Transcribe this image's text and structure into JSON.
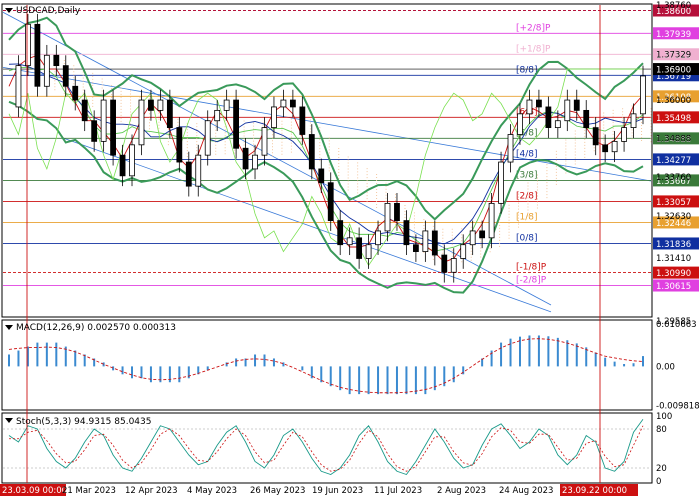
{
  "chart_data": {
    "type": "candlestick",
    "symbol_label": "USDCAD,Daily",
    "y_range": [
      1.2973,
      1.3876
    ],
    "y_ticks": [
      "1.38760",
      "1.37329",
      "1.36000",
      "1.34888",
      "1.33760",
      "1.32630",
      "1.31410",
      "1.29585"
    ],
    "x_ticks": [
      "23.03.09 00:00",
      "21 Mar 2023",
      "12 Apr 2023",
      "4 May 2023",
      "26 May 2023",
      "19 Jun 2023",
      "11 Jul 2023",
      "2 Aug 2023",
      "24 Aug 2023",
      "23.09.22 00:00"
    ],
    "close_path": [
      1.358,
      1.37,
      1.382,
      1.364,
      1.373,
      1.37,
      1.364,
      1.36,
      1.354,
      1.348,
      1.36,
      1.344,
      1.338,
      1.347,
      1.36,
      1.357,
      1.36,
      1.352,
      1.342,
      1.335,
      1.344,
      1.354,
      1.357,
      1.36,
      1.346,
      1.34,
      1.344,
      1.352,
      1.358,
      1.36,
      1.358,
      1.35,
      1.34,
      1.336,
      1.325,
      1.318,
      1.32,
      1.314,
      1.318,
      1.322,
      1.33,
      1.325,
      1.318,
      1.316,
      1.322,
      1.315,
      1.31,
      1.314,
      1.318,
      1.322,
      1.32,
      1.33,
      1.342,
      1.35,
      1.356,
      1.36,
      1.358,
      1.352,
      1.354,
      1.36,
      1.357,
      1.352,
      1.347,
      1.345,
      1.348,
      1.352,
      1.356,
      1.367
    ],
    "murrey_levels": [
      {
        "price": "1.38600",
        "label": "",
        "color": "#b5103a",
        "line": "#b5103a"
      },
      {
        "price": "1.37939",
        "label": "[+2/8]P",
        "color": "#e040e0",
        "line": "#e040e0"
      },
      {
        "price": "1.37329",
        "label": "[+1/8]P",
        "color": "#f0b0d0",
        "line": "#f0b0d0"
      },
      {
        "price": "1.36719",
        "label": "[8/8]",
        "color": "#1030a0",
        "line": "#1030a0"
      },
      {
        "price": "1.36108",
        "label": "",
        "color": "#e8a030",
        "line": "#e8a030"
      },
      {
        "price": "1.35498",
        "label": "[6/8]",
        "color": "#cc1010",
        "line": "#cc1010"
      },
      {
        "price": "1.34888",
        "label": "[5/8]",
        "color": "#3a7a3a",
        "line": "#3a7a3a"
      },
      {
        "price": "1.34277",
        "label": "[4/8]",
        "color": "#1030a0",
        "line": "#1030a0"
      },
      {
        "price": "1.33667",
        "label": "[3/8]",
        "color": "#3a7a3a",
        "line": "#3a7a3a"
      },
      {
        "price": "1.33057",
        "label": "[2/8]",
        "color": "#cc1010",
        "line": "#cc1010"
      },
      {
        "price": "1.32446",
        "label": "[1/8]",
        "color": "#e8a030",
        "line": "#e8a030"
      },
      {
        "price": "1.31836",
        "label": "[0/8]",
        "color": "#1030a0",
        "line": "#1030a0"
      },
      {
        "price": "1.30990",
        "label": "[-1/8]P",
        "color": "#cc1010",
        "line": "#cc1010"
      },
      {
        "price": "1.30615",
        "label": "[-2/8]P",
        "color": "#e040e0",
        "line": "#e040e0"
      }
    ],
    "price_badge": {
      "value": "1.36900",
      "color": "#000000"
    },
    "macd": {
      "title": "MACD(12,26,9) 0.002570 0.000313",
      "y_ticks": [
        "0.010663",
        "0.00",
        "-0.009818"
      ],
      "y_range": [
        -0.0105,
        0.0112
      ],
      "hist": [
        0.003,
        0.004,
        0.005,
        0.006,
        0.006,
        0.006,
        0.005,
        0.004,
        0.003,
        0.002,
        0.001,
        -0.001,
        -0.002,
        -0.003,
        -0.003,
        -0.004,
        -0.004,
        -0.004,
        -0.004,
        -0.003,
        -0.002,
        -0.001,
        0.0,
        0.001,
        0.002,
        0.002,
        0.003,
        0.003,
        0.002,
        0.001,
        0.0,
        -0.001,
        -0.003,
        -0.004,
        -0.005,
        -0.006,
        -0.007,
        -0.007,
        -0.007,
        -0.007,
        -0.007,
        -0.007,
        -0.007,
        -0.007,
        -0.007,
        -0.006,
        -0.005,
        -0.004,
        -0.002,
        0.0,
        0.002,
        0.004,
        0.006,
        0.007,
        0.0075,
        0.0078,
        0.0078,
        0.0076,
        0.0072,
        0.0066,
        0.0058,
        0.0048,
        0.0035,
        0.0022,
        0.0012,
        0.0006,
        0.0008,
        0.0026
      ],
      "signal_color": "#cc1010",
      "hist_color": "#3a8ad0"
    },
    "stoch": {
      "title": "Stoch(5,3,3) 94.9315 85.0435",
      "y_ticks": [
        "100",
        "80",
        "20",
        "0"
      ],
      "levels": [
        80,
        20
      ],
      "k": [
        70,
        60,
        85,
        80,
        50,
        30,
        20,
        35,
        60,
        80,
        70,
        40,
        20,
        15,
        35,
        60,
        85,
        80,
        60,
        40,
        25,
        30,
        55,
        75,
        85,
        60,
        30,
        20,
        40,
        70,
        80,
        60,
        35,
        15,
        10,
        20,
        40,
        70,
        85,
        60,
        30,
        15,
        10,
        30,
        55,
        80,
        60,
        35,
        20,
        25,
        55,
        80,
        88,
        70,
        50,
        60,
        80,
        70,
        40,
        25,
        40,
        70,
        60,
        20,
        15,
        30,
        75,
        95
      ],
      "d": [
        65,
        65,
        75,
        78,
        62,
        42,
        28,
        30,
        48,
        70,
        72,
        55,
        32,
        20,
        28,
        48,
        72,
        80,
        70,
        50,
        32,
        30,
        45,
        65,
        80,
        70,
        45,
        28,
        32,
        55,
        75,
        68,
        45,
        25,
        15,
        18,
        32,
        58,
        78,
        68,
        42,
        22,
        15,
        22,
        45,
        68,
        68,
        45,
        28,
        24,
        42,
        68,
        82,
        78,
        60,
        58,
        72,
        72,
        52,
        32,
        35,
        58,
        62,
        38,
        22,
        25,
        55,
        85
      ],
      "k_color": "#1a9a8a",
      "d_color": "#cc1010"
    },
    "vlines": [
      {
        "label": "23.03.09 00:00"
      },
      {
        "label": "23.09.22 00:00"
      }
    ]
  }
}
